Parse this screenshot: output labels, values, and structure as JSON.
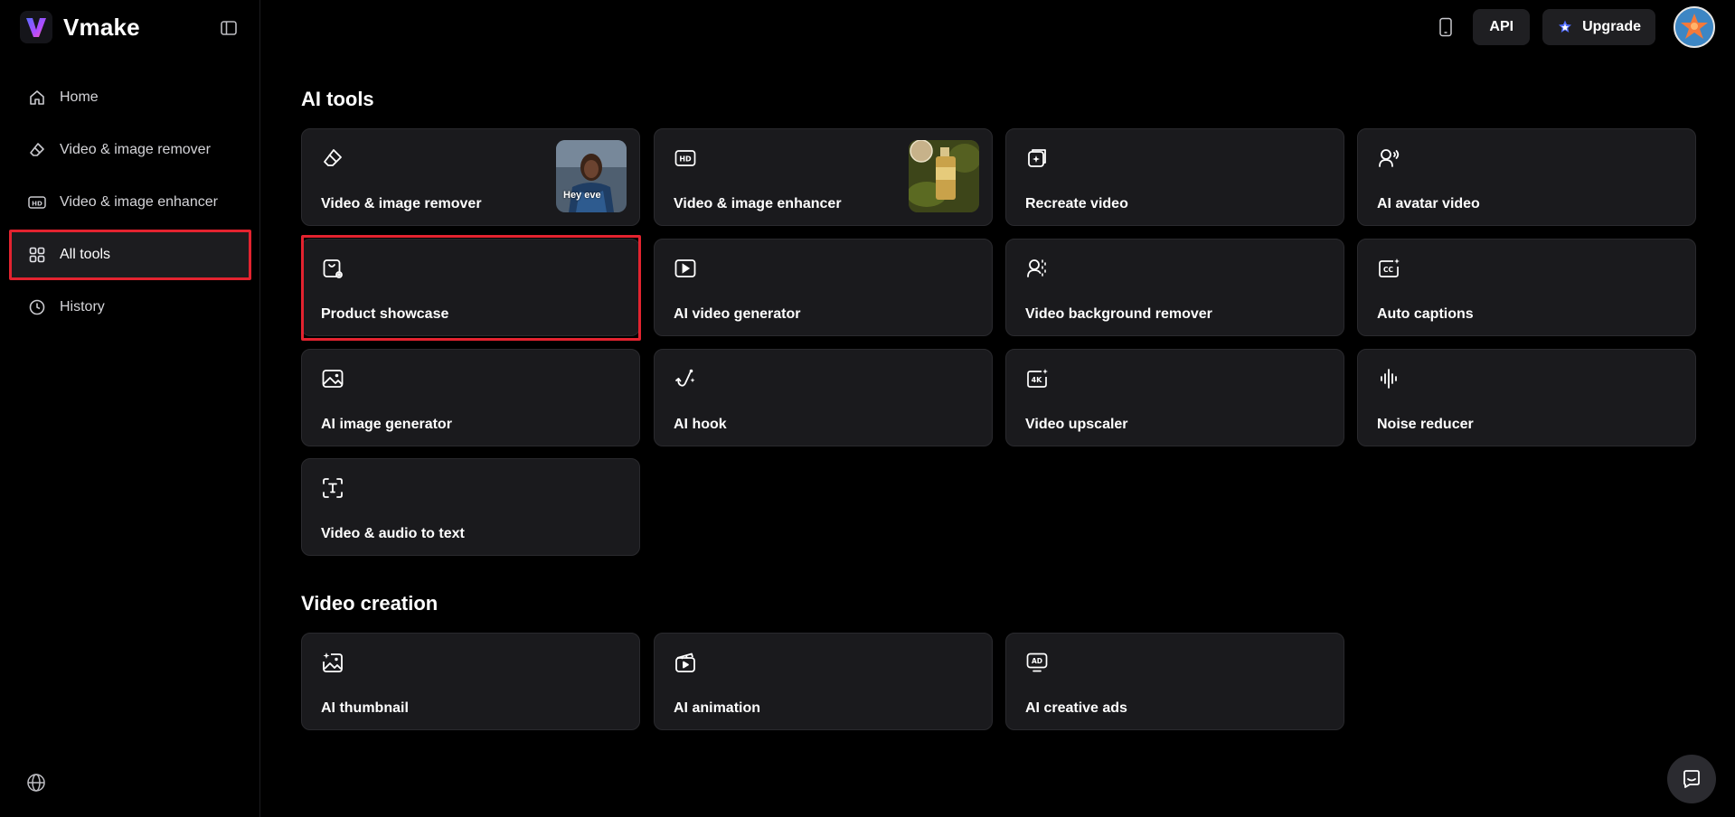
{
  "brand": {
    "name": "Vmake"
  },
  "sidebar": {
    "items": [
      {
        "label": "Home",
        "icon": "home-icon"
      },
      {
        "label": "Video & image remover",
        "icon": "eraser-icon"
      },
      {
        "label": "Video & image enhancer",
        "icon": "hd-icon"
      },
      {
        "label": "All tools",
        "icon": "grid-icon",
        "active": true
      },
      {
        "label": "History",
        "icon": "clock-icon"
      }
    ]
  },
  "header": {
    "api_label": "API",
    "upgrade_label": "Upgrade"
  },
  "sections": {
    "ai_tools": {
      "title": "AI tools",
      "cards": [
        {
          "label": "Video & image remover",
          "icon": "eraser-icon",
          "thumb_text": "Hey eve"
        },
        {
          "label": "Video & image enhancer",
          "icon": "hd-icon"
        },
        {
          "label": "Recreate video",
          "icon": "recreate-icon"
        },
        {
          "label": "AI avatar video",
          "icon": "avatar-voice-icon"
        },
        {
          "label": "Product showcase",
          "icon": "product-bag-icon",
          "highlighted": true
        },
        {
          "label": "AI video generator",
          "icon": "play-icon"
        },
        {
          "label": "Video background remover",
          "icon": "person-bg-icon"
        },
        {
          "label": "Auto captions",
          "icon": "cc-icon"
        },
        {
          "label": "AI image generator",
          "icon": "image-icon"
        },
        {
          "label": "AI hook",
          "icon": "hook-icon"
        },
        {
          "label": "Video upscaler",
          "icon": "4k-icon"
        },
        {
          "label": "Noise reducer",
          "icon": "waveform-icon"
        },
        {
          "label": "Video & audio to text",
          "icon": "text-scan-icon"
        }
      ]
    },
    "video_creation": {
      "title": "Video creation",
      "cards": [
        {
          "label": "AI thumbnail",
          "icon": "thumbnail-icon"
        },
        {
          "label": "AI animation",
          "icon": "animation-icon"
        },
        {
          "label": "AI creative ads",
          "icon": "ad-icon"
        }
      ]
    }
  },
  "colors": {
    "background": "#000000",
    "card": "#1a1a1d",
    "highlight": "#e3232f",
    "accent": "#4f6bff"
  }
}
